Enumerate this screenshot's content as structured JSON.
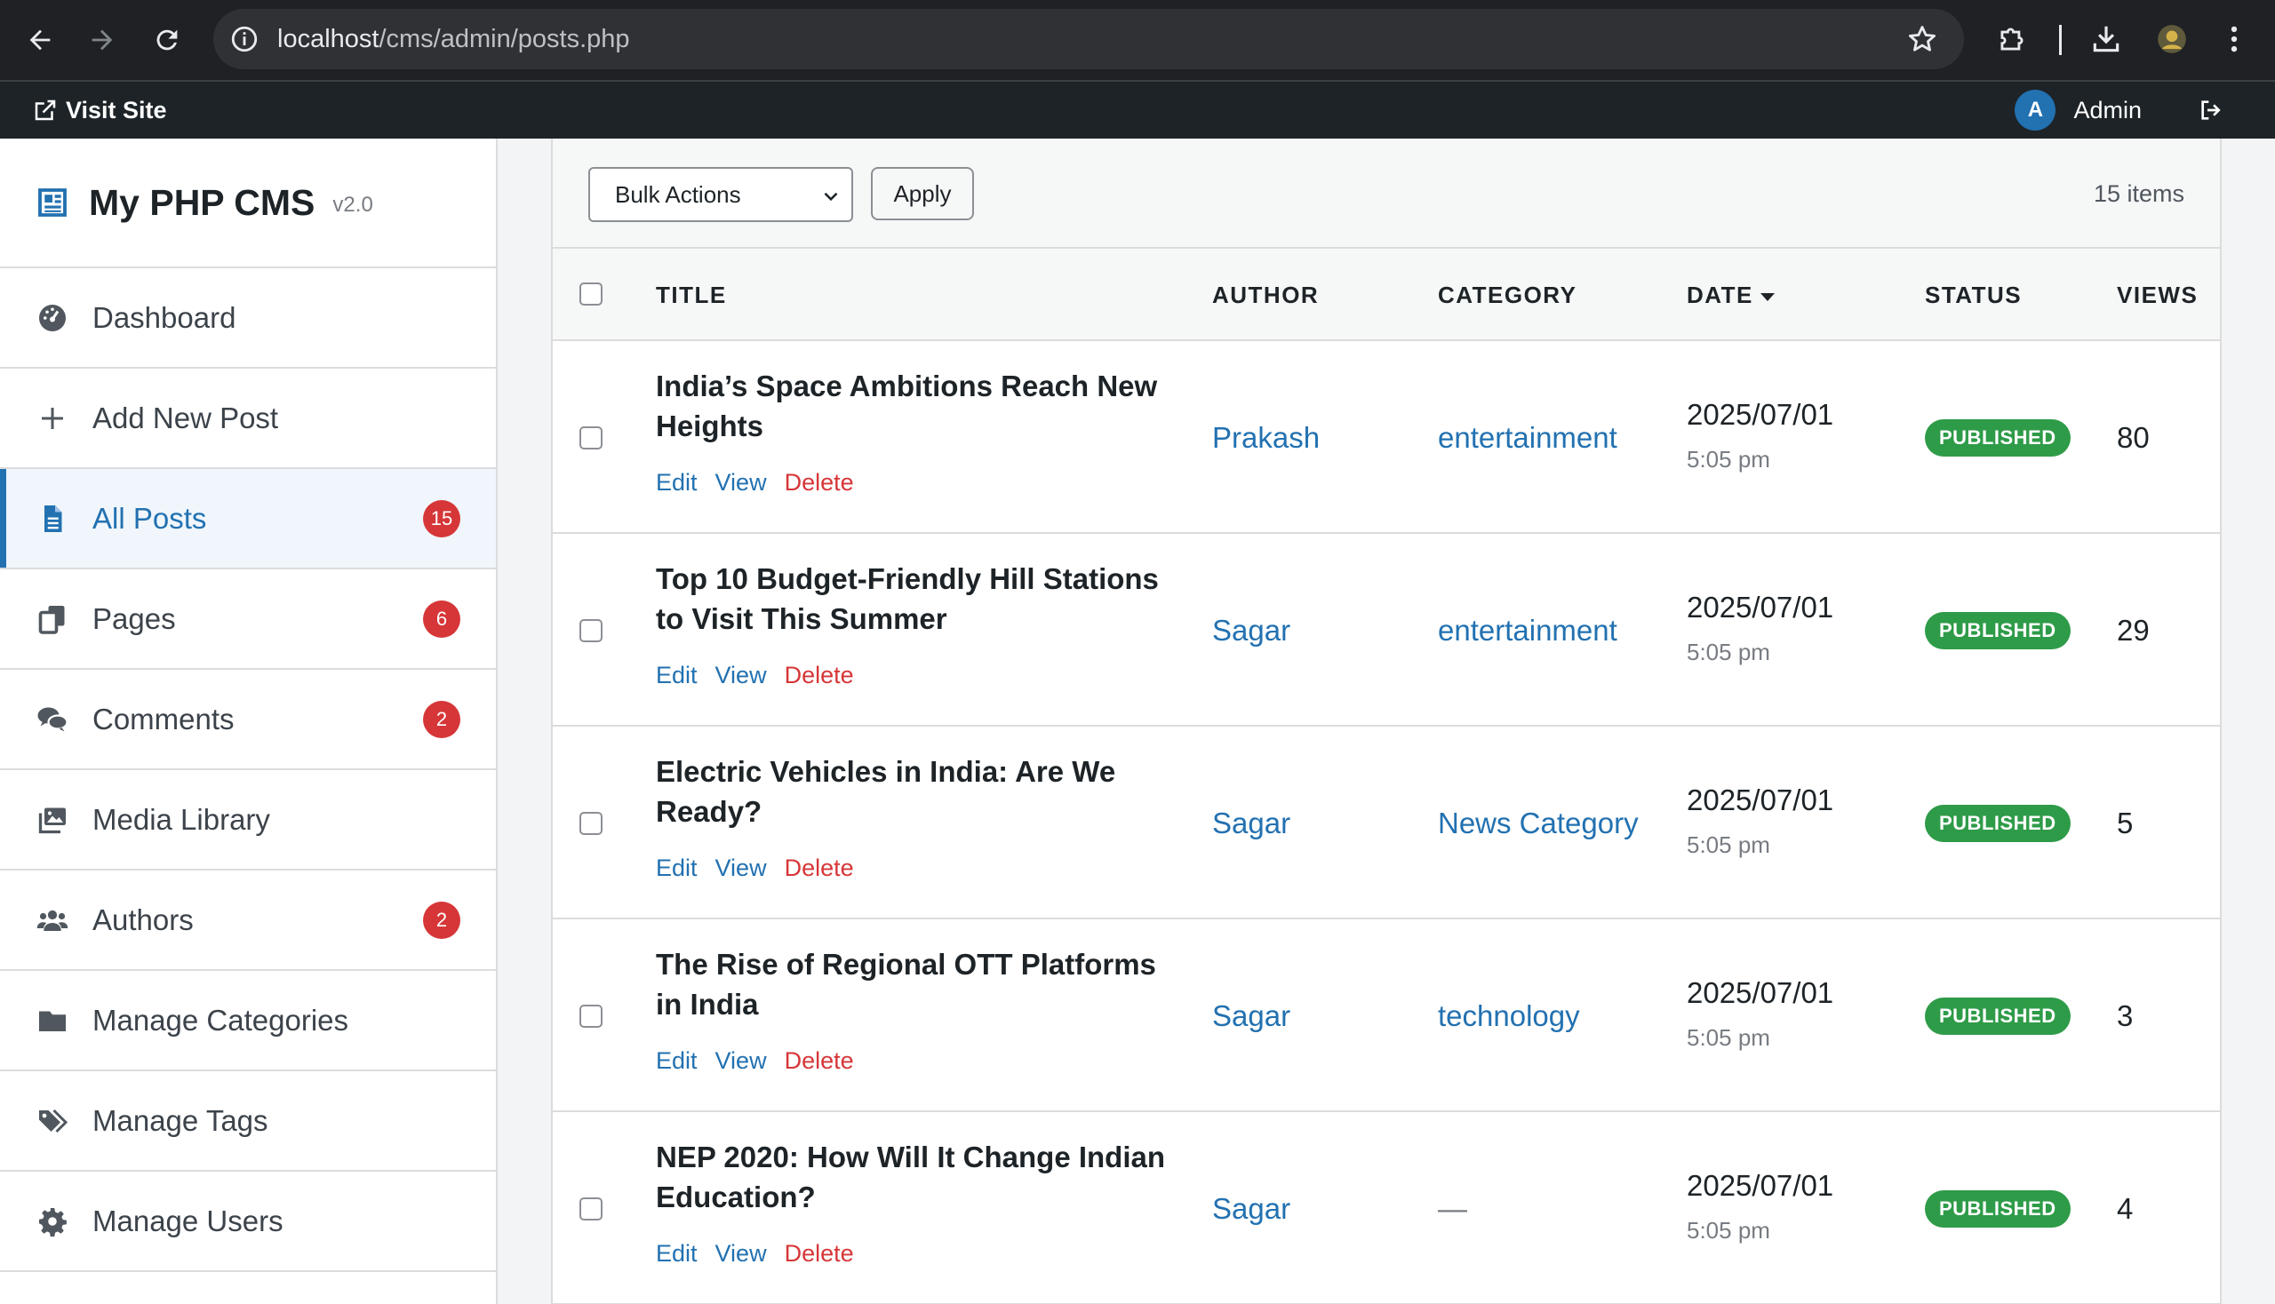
{
  "browser": {
    "url_host": "localhost",
    "url_path": "/cms/admin/posts.php"
  },
  "admin_bar": {
    "visit_site": "Visit Site",
    "avatar_letter": "A",
    "user_name": "Admin"
  },
  "brand": {
    "name": "My PHP CMS",
    "version": "v2.0"
  },
  "sidebar": {
    "items": [
      {
        "label": "Dashboard",
        "icon": "dashboard-icon",
        "badge": "",
        "active": false
      },
      {
        "label": "Add New Post",
        "icon": "plus-icon",
        "badge": "",
        "active": false
      },
      {
        "label": "All Posts",
        "icon": "document-icon",
        "badge": "15",
        "active": true
      },
      {
        "label": "Pages",
        "icon": "pages-icon",
        "badge": "6",
        "active": false
      },
      {
        "label": "Comments",
        "icon": "comments-icon",
        "badge": "2",
        "active": false
      },
      {
        "label": "Media Library",
        "icon": "media-icon",
        "badge": "",
        "active": false
      },
      {
        "label": "Authors",
        "icon": "users-icon",
        "badge": "2",
        "active": false
      },
      {
        "label": "Manage Categories",
        "icon": "folder-icon",
        "badge": "",
        "active": false
      },
      {
        "label": "Manage Tags",
        "icon": "tags-icon",
        "badge": "",
        "active": false
      },
      {
        "label": "Manage Users",
        "icon": "gear-icon",
        "badge": "",
        "active": false
      }
    ]
  },
  "toolbar": {
    "bulk_actions": "Bulk Actions",
    "apply": "Apply",
    "items_count": "15 items"
  },
  "table": {
    "headers": {
      "title": "TITLE",
      "author": "AUTHOR",
      "category": "CATEGORY",
      "date": "DATE",
      "status": "STATUS",
      "views": "VIEWS"
    },
    "actions": {
      "edit": "Edit",
      "view": "View",
      "delete": "Delete"
    },
    "rows": [
      {
        "title": "India’s Space Ambitions Reach New Heights",
        "author": "Prakash",
        "category": "entertainment",
        "date": "2025/07/01",
        "time": "5:05 pm",
        "status": "PUBLISHED",
        "views": "80"
      },
      {
        "title": "Top 10 Budget-Friendly Hill Stations to Visit This Summer",
        "author": "Sagar",
        "category": "entertainment",
        "date": "2025/07/01",
        "time": "5:05 pm",
        "status": "PUBLISHED",
        "views": "29"
      },
      {
        "title": "Electric Vehicles in India: Are We Ready?",
        "author": "Sagar",
        "category": "News Category",
        "date": "2025/07/01",
        "time": "5:05 pm",
        "status": "PUBLISHED",
        "views": "5"
      },
      {
        "title": "The Rise of Regional OTT Platforms in India",
        "author": "Sagar",
        "category": "technology",
        "date": "2025/07/01",
        "time": "5:05 pm",
        "status": "PUBLISHED",
        "views": "3"
      },
      {
        "title": "NEP 2020: How Will It Change Indian Education?",
        "author": "Sagar",
        "category": "—",
        "date": "2025/07/01",
        "time": "5:05 pm",
        "status": "PUBLISHED",
        "views": "4"
      }
    ]
  },
  "colors": {
    "accent": "#2271b1",
    "badge": "#d63638",
    "published": "#2e9b48",
    "admin_bar": "#1d2327"
  }
}
